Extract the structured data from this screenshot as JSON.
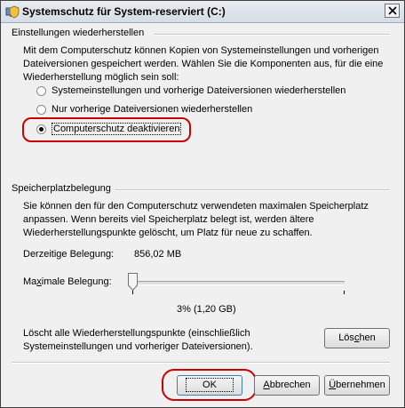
{
  "window": {
    "title": "Systemschutz für System-reserviert (C:)",
    "icon": "shield-computer-icon",
    "close_icon": "close-icon"
  },
  "restore_group": {
    "title": "Einstellungen wiederherstellen",
    "description_lines": [
      "Mit dem Computerschutz können Kopien von Systemeinstellungen und vorherigen",
      "Dateiversionen gespeichert werden. Wählen Sie die Komponenten aus, für die eine",
      "Wiederherstellung möglich sein soll:"
    ],
    "options": [
      {
        "label": "Systemeinstellungen und vorherige Dateiversionen wiederherstellen",
        "checked": false
      },
      {
        "label": "Nur vorherige Dateiversionen wiederherstellen",
        "checked": false
      },
      {
        "label": "Computerschutz deaktivieren",
        "checked": true
      }
    ]
  },
  "disk_group": {
    "title": "Speicherplatzbelegung",
    "description_lines": [
      "Sie können den für den Computerschutz verwendeten maximalen Speicherplatz",
      "anpassen. Wenn bereits viel Speicherplatz belegt ist, werden ältere",
      "Wiederherstellungspunkte gelöscht, um Platz für neue zu schaffen."
    ],
    "current_usage_label": "Derzeitige Belegung:",
    "current_usage_value": "856,02 MB",
    "max_usage_label_pre": "Ma",
    "max_usage_label_ul": "x",
    "max_usage_label_post": "imale Belegung:",
    "slider_percent": 3,
    "slider_value_text": "3% (1,20 GB)",
    "delete_text_lines": [
      "Löscht alle Wiederherstellungspunkte (einschließlich",
      "Systemeinstellungen und vorheriger Dateiversionen)."
    ],
    "delete_button_pre": "Lös",
    "delete_button_ul": "c",
    "delete_button_post": "hen"
  },
  "footer": {
    "ok_label": "OK",
    "cancel_label_ul": "A",
    "cancel_label_post": "bbrechen",
    "apply_label_ul": "Ü",
    "apply_label_post": "bernehmen"
  },
  "colors": {
    "highlight": "#cc0000"
  }
}
